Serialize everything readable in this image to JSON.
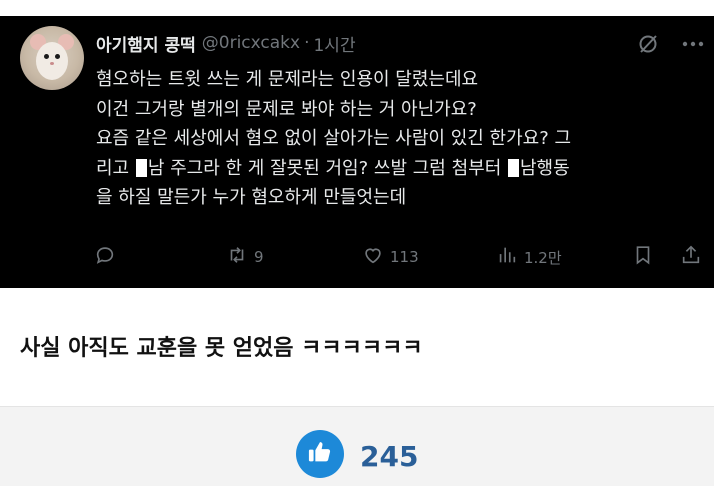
{
  "tweet": {
    "display_name": "아기햄지 콩떡",
    "handle": "@0ricxcakx",
    "separator": "·",
    "time": "1시간",
    "lines": [
      "혐오하는 트윗 쓰는 게 문제라는 인용이 달렸는데요",
      "이건 그거랑 별개의 문제로 봐야 하는 거 아닌가요?",
      "요즘 같은 세상에서 혐오 없이 살아가는 사람이 있긴 한가요? 그",
      "리고 ",
      "남 주그라 한 게 잘못된 거임? 쓰발 그럼 첨부터 ",
      "남행동",
      "을 하질 말든가 누가 혐오하게 만들엇는데"
    ],
    "icons": {
      "grok": "grok-slash-circle-icon",
      "more": "more-dots-icon"
    },
    "actions": {
      "reply_icon": "reply-bubble-icon",
      "retweet_icon": "retweet-icon",
      "retweets": "9",
      "like_icon": "heart-icon",
      "likes": "113",
      "views_icon": "views-bar-icon",
      "views": "1.2만",
      "bookmark_icon": "bookmark-icon",
      "share_icon": "share-icon"
    },
    "colors": {
      "background": "#000000",
      "text": "#e7e9ea",
      "muted": "#71767b"
    }
  },
  "post": {
    "comment": "사실 아직도 교훈을 못 얻었음 ㅋㅋㅋㅋㅋㅋ",
    "like_icon": "thumbs-up-icon",
    "like_count": "245",
    "like_color": "#1d89d8",
    "count_color": "#2a5f98"
  }
}
